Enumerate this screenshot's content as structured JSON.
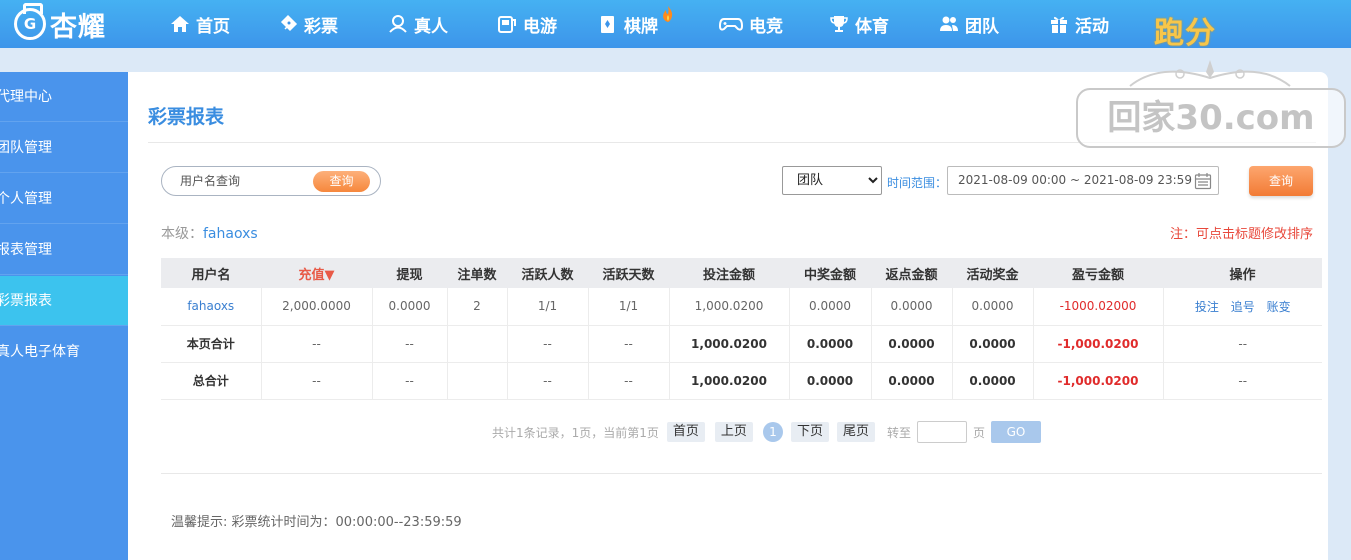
{
  "brand": {
    "name": "杏耀",
    "logo_letter": "G"
  },
  "nav": [
    {
      "label": "首页",
      "icon": "home-icon"
    },
    {
      "label": "彩票",
      "icon": "ticket-icon"
    },
    {
      "label": "真人",
      "icon": "person-icon"
    },
    {
      "label": "电游",
      "icon": "slot-icon"
    },
    {
      "label": "棋牌",
      "icon": "cards-icon"
    },
    {
      "label": "电竞",
      "icon": "gamepad-icon"
    },
    {
      "label": "体育",
      "icon": "trophy-icon"
    },
    {
      "label": "团队",
      "icon": "team-icon"
    },
    {
      "label": "活动",
      "icon": "gift-icon"
    }
  ],
  "promo": "跑分",
  "sidebar": [
    {
      "label": "代理中心"
    },
    {
      "label": "团队管理"
    },
    {
      "label": "个人管理"
    },
    {
      "label": "报表管理"
    },
    {
      "label": "彩票报表"
    },
    {
      "label": "真人电子体育"
    }
  ],
  "page": {
    "title": "彩票报表",
    "search_placeholder": "用户名查询",
    "search_button": "查询",
    "scope_selected": "团队",
    "range_label": "时间范围：",
    "range_value": "2021-08-09 00:00 ~ 2021-08-09 23:59",
    "query_button": "查询",
    "level_prefix": "本级：",
    "level_user": "fahaoxs",
    "sort_note": "注：可点击标题修改排序"
  },
  "table": {
    "headers": [
      "用户名",
      "充值▼",
      "提现",
      "注单数",
      "活跃人数",
      "活跃天数",
      "投注金额",
      "中奖金额",
      "返点金额",
      "活动奖金",
      "盈亏金额",
      "操作"
    ],
    "row": {
      "user": "fahaoxs",
      "recharge": "2,000.0000",
      "withdraw": "0.0000",
      "orders": "2",
      "active_users": "1/1",
      "active_days": "1/1",
      "bet": "1,000.0200",
      "win": "0.0000",
      "rebate": "0.0000",
      "bonus": "0.0000",
      "profit": "-1000.02000",
      "ops": [
        "投注",
        "追号",
        "账变"
      ]
    },
    "page_total": {
      "label": "本页合计",
      "recharge": "--",
      "withdraw": "--",
      "orders": "",
      "active_users": "--",
      "active_days": "--",
      "bet": "1,000.0200",
      "win": "0.0000",
      "rebate": "0.0000",
      "bonus": "0.0000",
      "profit": "-1,000.0200",
      "ops": "--"
    },
    "grand_total": {
      "label": "总合计",
      "recharge": "--",
      "withdraw": "--",
      "orders": "",
      "active_users": "--",
      "active_days": "--",
      "bet": "1,000.0200",
      "win": "0.0000",
      "rebate": "0.0000",
      "bonus": "0.0000",
      "profit": "-1,000.0200",
      "ops": "--"
    }
  },
  "pager": {
    "summary": "共计1条记录，1页，当前第1页",
    "first": "首页",
    "prev": "上页",
    "current": "1",
    "next": "下页",
    "last": "尾页",
    "jump_label": "转至",
    "page_unit": "页",
    "go": "GO"
  },
  "tip": "温馨提示: 彩票统计时间为：00:00:00--23:59:59",
  "watermark": "回家30.com",
  "colors": {
    "nav_blue": "#3d95ea",
    "sidebar_blue": "#4a94ec",
    "active_cyan": "#3cc3ee",
    "orange": "#f6873c",
    "loss_red": "#e02b2b"
  }
}
